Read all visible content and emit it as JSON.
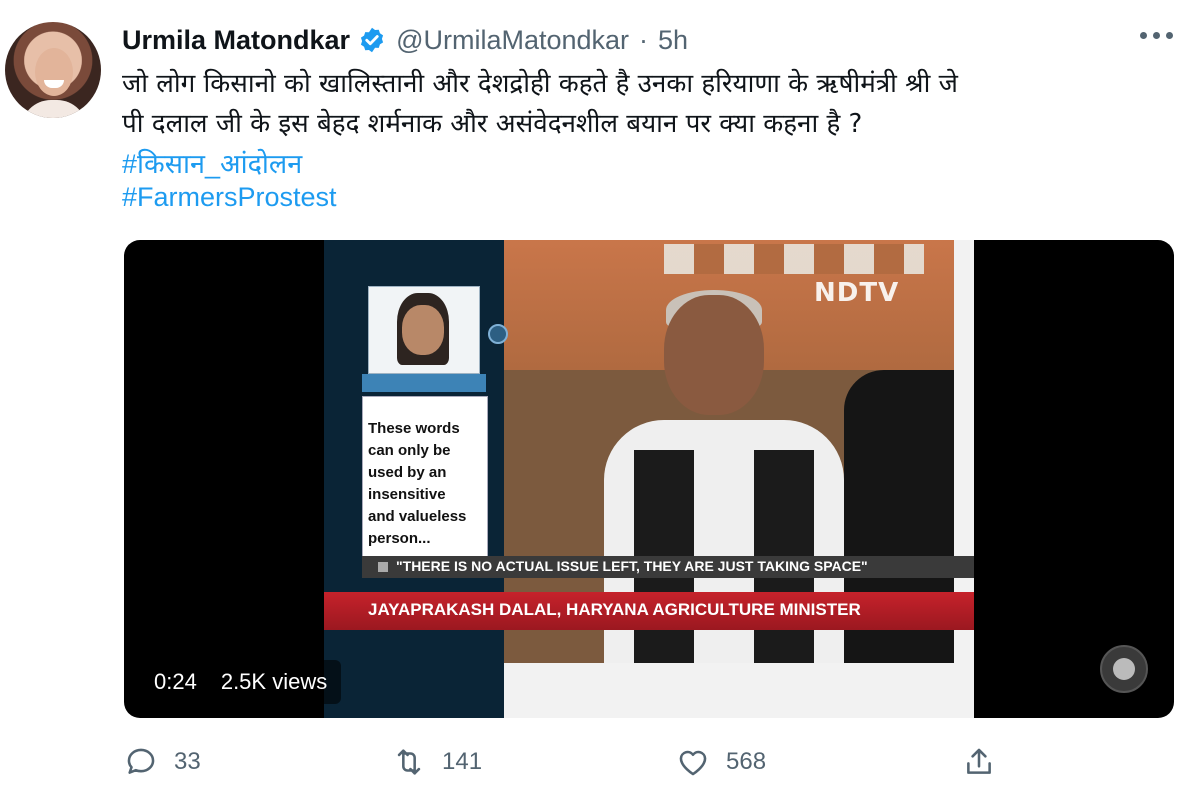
{
  "author": {
    "name": "Urmila Matondkar",
    "handle": "@UrmilaMatondkar",
    "separator": "·",
    "time": "5h"
  },
  "tweet": {
    "line1": "जो लोग किसानो को खालिस्तानी और देशद्रोही कहते है उनका हरियाणा के ऋषीमंत्री श्री जे",
    "line2": "पी दलाल जी के इस बेहद शर्मनाक और  असंवेदनशील बयान पर क्या कहना है ?",
    "hashtags": [
      "#किसान_आंदोलन",
      "#FarmersProstest"
    ]
  },
  "video": {
    "channel_logo": "NDTV",
    "quote": "These words\ncan only be\nused by an\ninsensitive\nand valueless\nperson...",
    "ticker": "\"THERE IS NO ACTUAL ISSUE LEFT, THEY ARE JUST TAKING SPACE\"",
    "lower_third": "JAYAPRAKASH DALAL, HARYANA AGRICULTURE MINISTER",
    "duration": "0:24",
    "views": "2.5K views"
  },
  "actions": {
    "replies": "33",
    "retweets": "141",
    "likes": "568"
  },
  "icons": {
    "verified": "verified-badge-icon",
    "more": "more-options-icon",
    "reply": "reply-icon",
    "retweet": "retweet-icon",
    "like": "heart-icon",
    "share": "share-icon"
  },
  "colors": {
    "link": "#1d9bf0",
    "secondary_text": "#536471",
    "lower_third": "#c6222b"
  }
}
